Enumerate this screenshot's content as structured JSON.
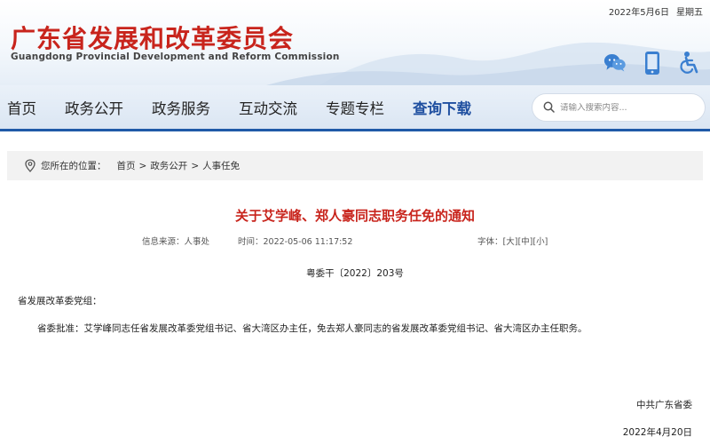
{
  "header": {
    "date": "2022年5月6日",
    "weekday": "星期五",
    "title": "广东省发展和改革委员会",
    "subtitle": "Guangdong Provincial Development and Reform Commission",
    "icons": [
      "wechat-icon",
      "mobile-icon",
      "accessibility-icon"
    ]
  },
  "nav": {
    "items": [
      {
        "label": "首页"
      },
      {
        "label": "政务公开"
      },
      {
        "label": "政务服务"
      },
      {
        "label": "互动交流"
      },
      {
        "label": "专题专栏"
      },
      {
        "label": "查询下载"
      }
    ],
    "active_index": 5
  },
  "search": {
    "placeholder": "请输入搜索内容..."
  },
  "breadcrumb": {
    "label": "您所在的位置：",
    "items": [
      "首页",
      "政务公开",
      "人事任免"
    ],
    "separator": ">"
  },
  "article": {
    "title": "关于艾学峰、郑人豪同志职务任免的通知",
    "source": "信息来源：人事处",
    "time": "时间：2022-05-06 11:17:52",
    "font_label": "字体：",
    "font_sizes": [
      "[大]",
      "[中]",
      "[小]"
    ],
    "doc_number": "粤委干〔2022〕203号",
    "addressee": "省发展改革委党组：",
    "body": "省委批准：艾学峰同志任省发展改革委党组书记、省大湾区办主任，免去郑人豪同志的省发展改革委党组书记、省大湾区办主任职务。",
    "signer": "中共广东省委",
    "sign_date": "2022年4月20日"
  },
  "colors": {
    "brand_red": "#c8241c",
    "nav_blue": "#1f5aa8",
    "active_nav": "#1f4fa0"
  }
}
